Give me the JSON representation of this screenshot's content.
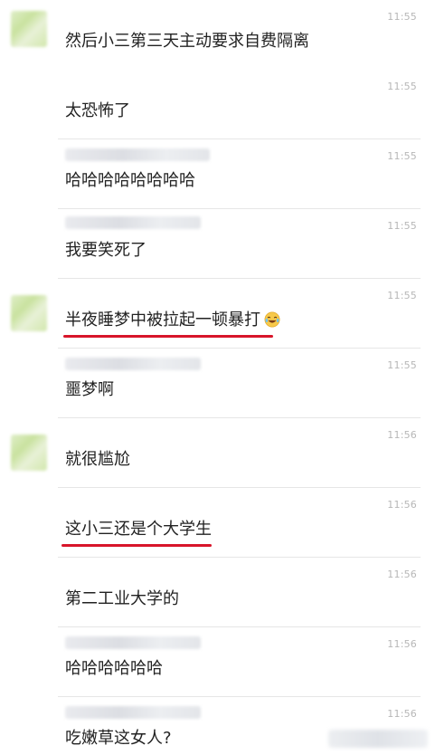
{
  "messages": [
    {
      "time": "11:55",
      "text": "然后小三第三天主动要求自费隔离",
      "avatar": true,
      "underlined": false
    },
    {
      "time": "11:55",
      "text": "太恐怖了",
      "avatar": false,
      "underlined": false
    },
    {
      "time": "11:55",
      "text": "哈哈哈哈哈哈哈哈",
      "avatar": false,
      "underlined": false
    },
    {
      "time": "11:55",
      "text": "我要笑死了",
      "avatar": false,
      "underlined": false
    },
    {
      "time": "11:55",
      "text": "半夜睡梦中被拉起一顿暴打",
      "avatar": true,
      "underlined": true,
      "emoji": "laughing-tears-emoji"
    },
    {
      "time": "11:55",
      "text": "噩梦啊",
      "avatar": false,
      "underlined": false
    },
    {
      "time": "11:56",
      "text": "就很尴尬",
      "avatar": true,
      "underlined": false
    },
    {
      "time": "11:56",
      "text": "这小三还是个大学生",
      "avatar": false,
      "underlined": true
    },
    {
      "time": "11:56",
      "text": "第二工业大学的",
      "avatar": false,
      "underlined": false
    },
    {
      "time": "11:56",
      "text": "哈哈哈哈哈哈",
      "avatar": false,
      "underlined": false
    },
    {
      "time": "11:56",
      "text": "吃嫩草这女人?",
      "avatar": false,
      "underlined": false
    }
  ],
  "colors": {
    "underline": "#d8152a",
    "time": "#b7b7b7",
    "text": "#222222",
    "divider": "#e6e6e6"
  }
}
